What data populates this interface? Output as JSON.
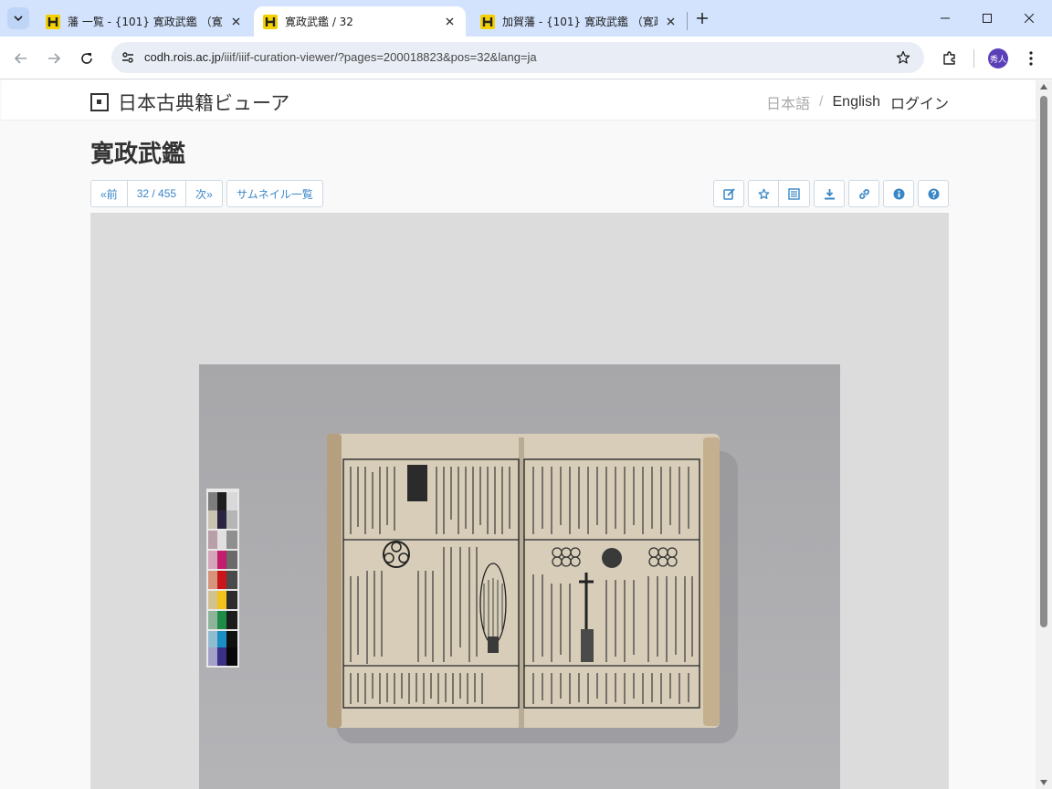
{
  "browser": {
    "tabs": [
      {
        "title": "藩 一覧 - {101} 寛政武鑑 （寛政",
        "active": false
      },
      {
        "title": "寛政武鑑 / 32",
        "active": true
      },
      {
        "title": "加賀藩 - {101} 寛政武鑑 （寛政",
        "active": false
      }
    ],
    "favicon_letter": "H",
    "url_host": "codh.rois.ac.jp",
    "url_path": "/iiif/iiif-curation-viewer/?pages=200018823&pos=32&lang=ja",
    "profile_initials": "秀人"
  },
  "site": {
    "brand": "日本古典籍ビューア",
    "lang_ja": "日本語",
    "slash": "/",
    "lang_en": "English",
    "login": "ログイン"
  },
  "viewer": {
    "title": "寛政武鑑",
    "prev": "«前",
    "page_indicator": "32 / 455",
    "next": "次»",
    "thumbnails": "サムネイル一覧",
    "accent_color": "#3a87c7"
  }
}
